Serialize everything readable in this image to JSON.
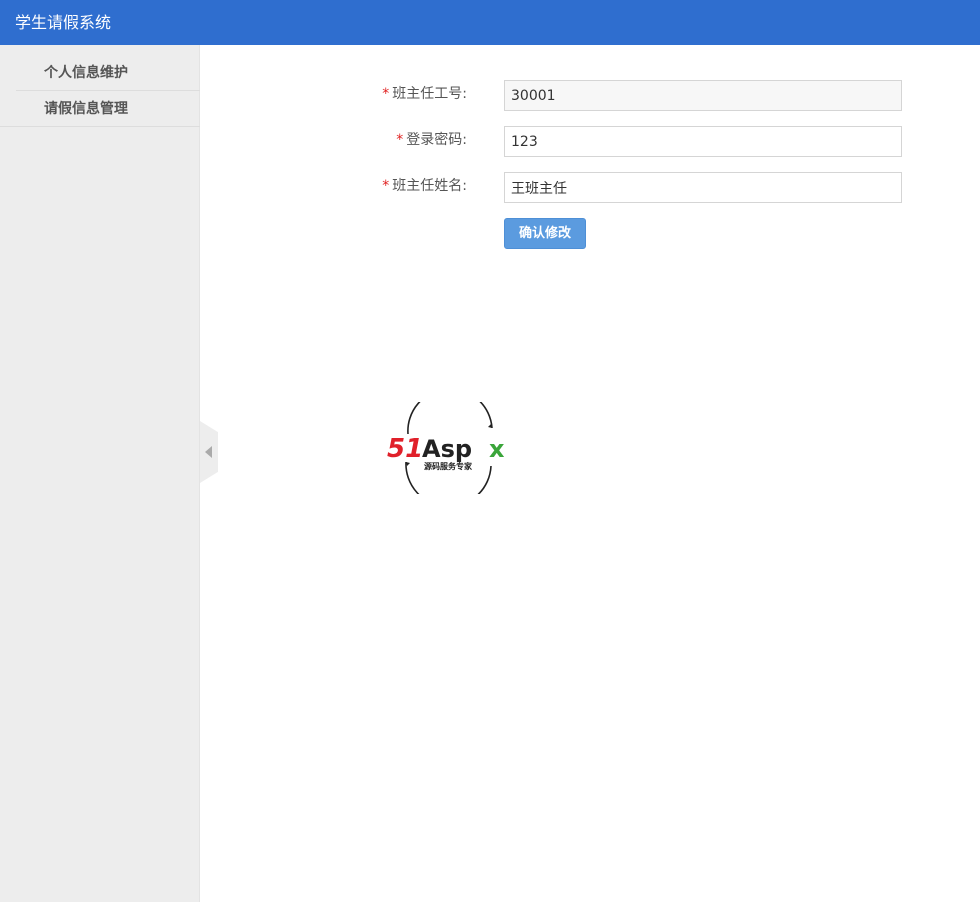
{
  "app": {
    "title": "学生请假系统"
  },
  "sidebar": {
    "items": [
      {
        "label": "个人信息维护"
      },
      {
        "label": "请假信息管理"
      }
    ]
  },
  "form": {
    "required_mark": "*",
    "fields": [
      {
        "label": "班主任工号:",
        "value": "30001",
        "readonly": true
      },
      {
        "label": "登录密码:",
        "value": "123",
        "readonly": false
      },
      {
        "label": "班主任姓名:",
        "value": "王班主任",
        "readonly": false
      }
    ],
    "submit_label": "确认修改"
  },
  "logo": {
    "text_main_red": "51",
    "text_main_dark": "Asp",
    "text_main_green": "x",
    "tagline": "源码服务专家"
  },
  "colors": {
    "header": "#2f6ecf",
    "sidebar": "#ededed",
    "button": "#5b9bdf",
    "required": "#e02020",
    "logo_red": "#e0202a",
    "logo_green": "#3aa53a"
  }
}
